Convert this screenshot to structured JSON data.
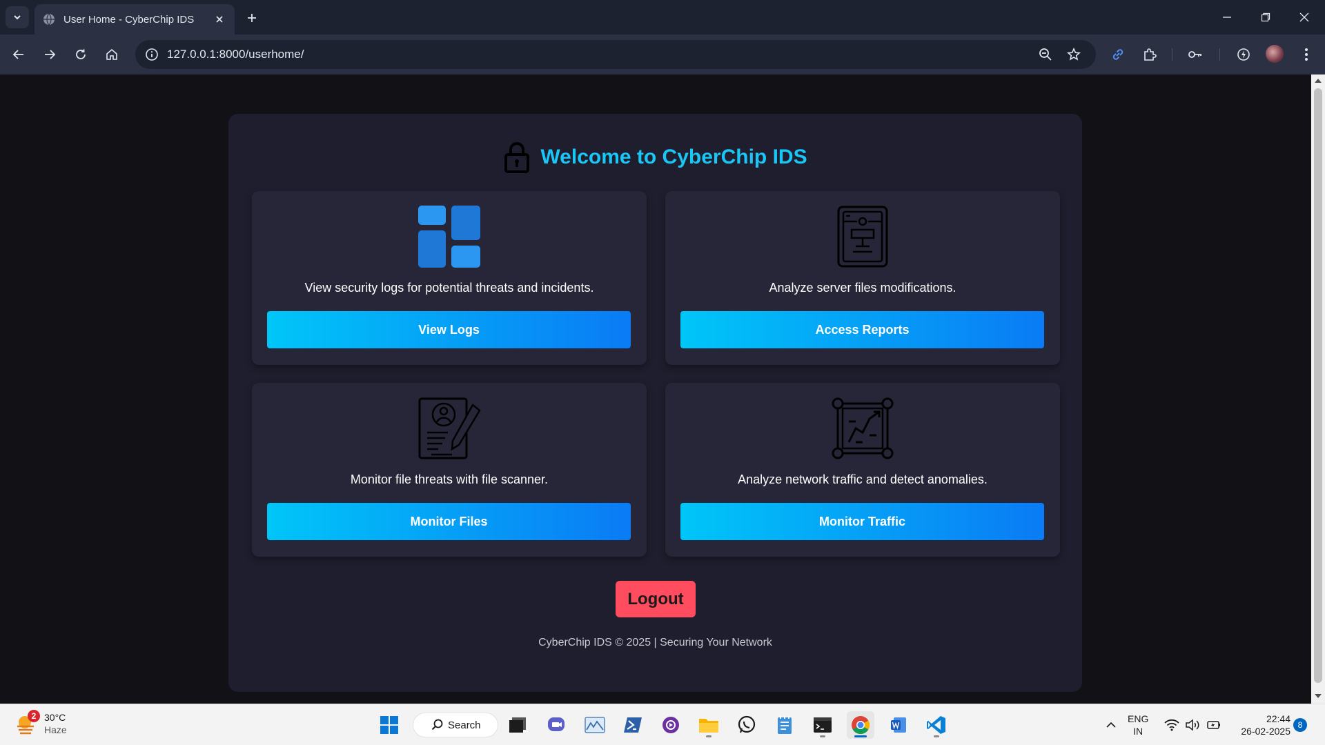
{
  "browser": {
    "tab_title": "User Home - CyberChip IDS",
    "url": "127.0.0.1:8000/userhome/"
  },
  "page": {
    "heading": "Welcome to CyberChip IDS",
    "cards": [
      {
        "description": "View security logs for potential threats and incidents.",
        "button": "View Logs",
        "icon": "dashboard-icon"
      },
      {
        "description": "Analyze server files modifications.",
        "button": "Access Reports",
        "icon": "server-icon"
      },
      {
        "description": "Monitor file threats with file scanner.",
        "button": "Monitor Files",
        "icon": "file-scanner-icon"
      },
      {
        "description": "Analyze network traffic and detect anomalies.",
        "button": "Monitor Traffic",
        "icon": "network-icon"
      }
    ],
    "logout": "Logout",
    "footer": "CyberChip IDS © 2025 | Securing Your Network",
    "colors": {
      "accent": "#19c6f5",
      "button_start": "#00c6f8",
      "button_end": "#0a7bf5",
      "logout": "#ff4c5e",
      "card_bg": "#262638",
      "panel_bg": "#1e1e2e"
    }
  },
  "taskbar": {
    "weather": {
      "temp": "30°C",
      "condition": "Haze",
      "badge": "2"
    },
    "search_label": "Search",
    "language": {
      "line1": "ENG",
      "line2": "IN"
    },
    "clock": {
      "time": "22:44",
      "date": "26-02-2025"
    },
    "notification_count": "8"
  }
}
